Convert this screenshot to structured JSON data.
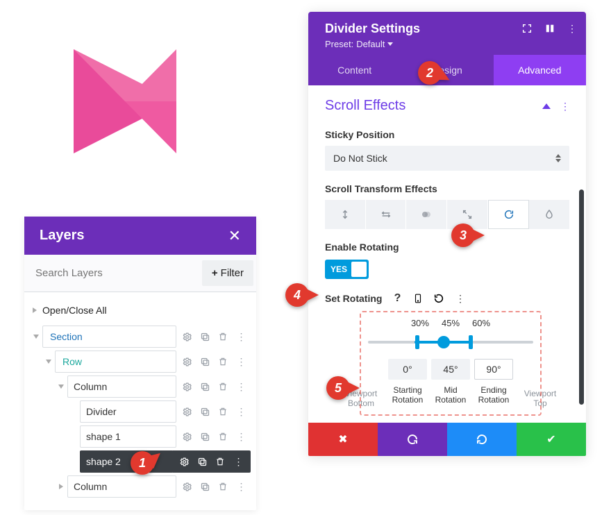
{
  "layers": {
    "title": "Layers",
    "search_placeholder": "Search Layers",
    "filter_label": "Filter",
    "open_close": "Open/Close All",
    "items": [
      {
        "kind": "section",
        "label": "Section"
      },
      {
        "kind": "row",
        "label": "Row"
      },
      {
        "kind": "column",
        "label": "Column"
      },
      {
        "kind": "module",
        "label": "Divider"
      },
      {
        "kind": "module",
        "label": "shape 1"
      },
      {
        "kind": "module-selected",
        "label": "shape 2"
      },
      {
        "kind": "column-collapsed",
        "label": "Column"
      }
    ]
  },
  "settings": {
    "title": "Divider Settings",
    "preset_prefix": "Preset:",
    "preset_value": "Default",
    "tabs": {
      "content": "Content",
      "design": "Design",
      "advanced": "Advanced"
    },
    "scroll_effects_title": "Scroll Effects",
    "sticky_label": "Sticky Position",
    "sticky_value": "Do Not Stick",
    "transform_label": "Scroll Transform Effects",
    "enable_rotating_label": "Enable Rotating",
    "toggle_yes": "YES",
    "set_rotating_label": "Set Rotating",
    "viewport_bottom": "Viewport Bottom",
    "viewport_top": "Viewport Top",
    "range": {
      "left": "30%",
      "mid": "45%",
      "right": "60%"
    },
    "rotation": {
      "start": "0°",
      "mid": "45°",
      "end": "90°",
      "cap_start_l1": "Starting",
      "cap_mid_l1": "Mid",
      "cap_end_l1": "Ending",
      "cap_l2": "Rotation"
    }
  },
  "markers": {
    "1": "1",
    "2": "2",
    "3": "3",
    "4": "4",
    "5": "5"
  }
}
